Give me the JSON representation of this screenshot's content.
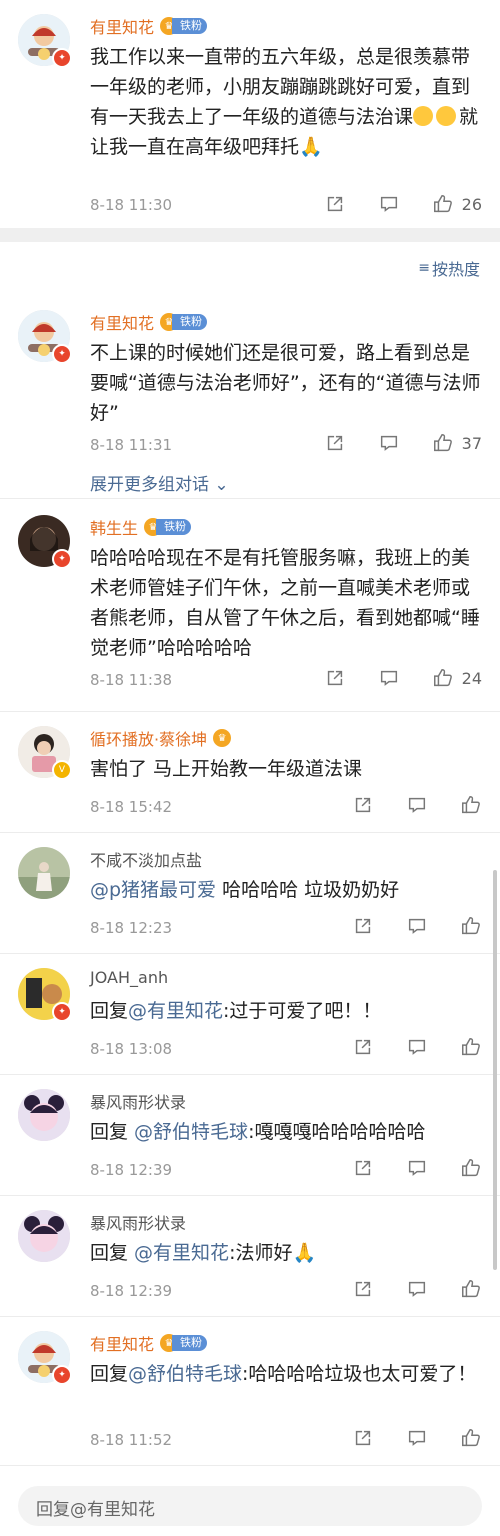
{
  "top_post": {
    "author": "有里知花",
    "badge": "铁粉",
    "text": "我工作以来一直带的五六年级，总是很羡慕带一年级的老师，小朋友蹦蹦跳跳好可爱，直到有一天我去上了一年级的道德与法治课",
    "text_tail": "就让我一直在高年级吧拜托🙏",
    "time": "8-18 11:30",
    "likes": "26"
  },
  "sort_label": "按热度",
  "comments": [
    {
      "author": "有里知花",
      "badge": "铁粉",
      "text": "不上课的时候她们还是很可爱，路上看到总是要喊“道德与法治老师好”，还有的“道德与法师好”",
      "time": "8-18 11:31",
      "likes": "37",
      "expand": "展开更多组对话"
    },
    {
      "author": "韩生生",
      "badge": "铁粉",
      "text": "哈哈哈哈现在不是有托管服务嘛，我班上的美术老师管娃子们午休，之前一直喊美术老师或者熊老师，自从管了午休之后，看到她都喊“睡觉老师”哈哈哈哈哈",
      "time": "8-18 11:38",
      "likes": "24"
    },
    {
      "author": "循环播放·蔡徐坤",
      "text": "害怕了 马上开始教一年级道法课",
      "time": "8-18 15:42"
    },
    {
      "author": "不咸不淡加点盐",
      "mention": "@p猪猪最可爱",
      "text": " 哈哈哈哈 垃圾奶奶好",
      "time": "8-18 12:23"
    },
    {
      "author": "JOAH_anh",
      "prefix": "回复",
      "mention": "@有里知花",
      "text": ":过于可爱了吧！！",
      "time": "8-18 13:08"
    },
    {
      "author": "暴风雨形状录",
      "prefix": "回复 ",
      "mention": "@舒伯特毛球",
      "text": ":嘎嘎嘎哈哈哈哈哈哈",
      "time": "8-18 12:39"
    },
    {
      "author": "暴风雨形状录",
      "prefix": "回复 ",
      "mention": "@有里知花",
      "text": ":法师好🙏",
      "time": "8-18 12:39"
    },
    {
      "author": "有里知花",
      "badge": "铁粉",
      "prefix": "回复",
      "mention": "@舒伯特毛球",
      "text": ":哈哈哈哈垃圾也太可爱了！",
      "time": "8-18 11:52"
    }
  ],
  "reply_placeholder": "回复@有里知花",
  "icons": {
    "share": "share-icon",
    "comment": "comment-icon",
    "like": "thumbs-up-icon",
    "sort": "sort-icon",
    "crown": "crown-badge-icon"
  },
  "colors": {
    "name_orange": "#e26f23",
    "link_blue": "#4a6a93",
    "badge_blue": "#5b8fd6"
  }
}
